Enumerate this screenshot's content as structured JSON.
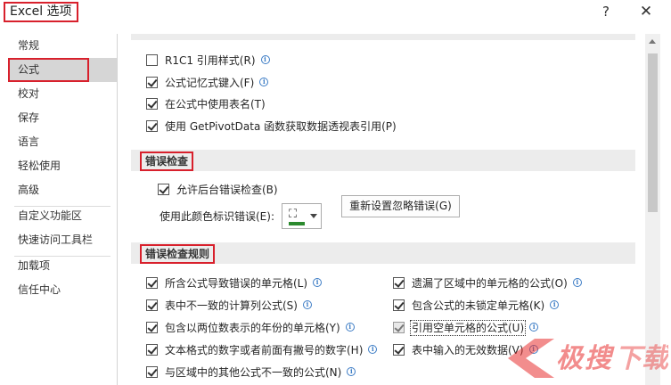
{
  "window": {
    "title": "Excel 选项",
    "help_label": "?",
    "close_label": "✕"
  },
  "sidebar": {
    "items": [
      {
        "label": "常规"
      },
      {
        "label": "公式"
      },
      {
        "label": "校对"
      },
      {
        "label": "保存"
      },
      {
        "label": "语言"
      },
      {
        "label": "轻松使用"
      },
      {
        "label": "高级"
      },
      {
        "label": "自定义功能区"
      },
      {
        "label": "快速访问工具栏"
      },
      {
        "label": "加载项"
      },
      {
        "label": "信任中心"
      }
    ],
    "selected": "公式"
  },
  "formulas": {
    "options": [
      {
        "label": "R1C1 引用样式(R)",
        "checked": false
      },
      {
        "label": "公式记忆式键入(F)",
        "checked": true
      },
      {
        "label": "在公式中使用表名(T)",
        "checked": true
      },
      {
        "label": "使用 GetPivotData 函数获取数据透视表引用(P)",
        "checked": true
      }
    ]
  },
  "error_checking": {
    "header": "错误检查",
    "enable_label": "允许后台错误检查(B)",
    "enable_checked": true,
    "color_label": "使用此颜色标识错误(E):",
    "color": "#2b8a2e",
    "reset_button": "重新设置忽略错误(G)"
  },
  "error_rules": {
    "header": "错误检查规则",
    "left": [
      {
        "label": "所含公式导致错误的单元格(L)",
        "checked": true
      },
      {
        "label": "表中不一致的计算列公式(S)",
        "checked": true
      },
      {
        "label": "包含以两位数表示的年份的单元格(Y)",
        "checked": true
      },
      {
        "label": "文本格式的数字或者前面有撇号的数字(H)",
        "checked": true
      },
      {
        "label": "与区域中的其他公式不一致的公式(N)",
        "checked": true
      }
    ],
    "right": [
      {
        "label": "遗漏了区域中的单元格的公式(O)",
        "checked": true
      },
      {
        "label": "包含公式的未锁定单元格(K)",
        "checked": true
      },
      {
        "label": "引用空单元格的公式(U)",
        "checked": true,
        "disabled_look": true
      },
      {
        "label": "表中输入的无效数据(V)",
        "checked": true
      }
    ]
  },
  "icons": {
    "info": "info-icon",
    "bucket": "paint-bucket-icon",
    "dropdown": "chevron-down-icon"
  },
  "watermark": {
    "text": "下载"
  }
}
